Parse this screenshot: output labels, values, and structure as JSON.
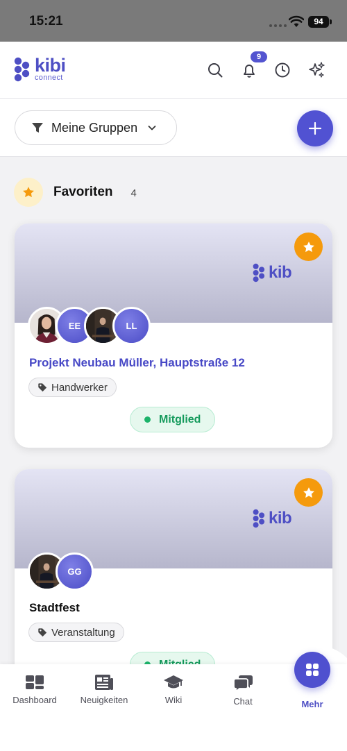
{
  "status_bar": {
    "time": "15:21",
    "battery": "94"
  },
  "app": {
    "logo_main": "kibi",
    "logo_sub": "connect",
    "notification_count": "9"
  },
  "filter": {
    "label": "Meine Gruppen"
  },
  "section": {
    "title": "Favoriten",
    "count": "4"
  },
  "groups": [
    {
      "banner_logo": "kib",
      "avatars": [
        "",
        "EE",
        "",
        "LL"
      ],
      "title": "Projekt Neubau Müller, Hauptstraße 12",
      "tag": "Handwerker",
      "status": "Mitglied"
    },
    {
      "banner_logo": "kib",
      "avatars": [
        "",
        "GG"
      ],
      "title": "Stadtfest",
      "tag": "Veranstaltung",
      "status": "Mitglied"
    }
  ],
  "tabs": [
    {
      "label": "Dashboard",
      "icon": "dashboard-icon"
    },
    {
      "label": "Neuigkeiten",
      "icon": "newspaper-icon"
    },
    {
      "label": "Wiki",
      "icon": "graduation-cap-icon"
    },
    {
      "label": "Chat",
      "icon": "chat-bubbles-icon"
    },
    {
      "label": "Mehr",
      "icon": "grid-icon"
    }
  ],
  "colors": {
    "brand": "#4e4fc4",
    "favorite": "#f59a0c",
    "member_green": "#159a5c"
  }
}
